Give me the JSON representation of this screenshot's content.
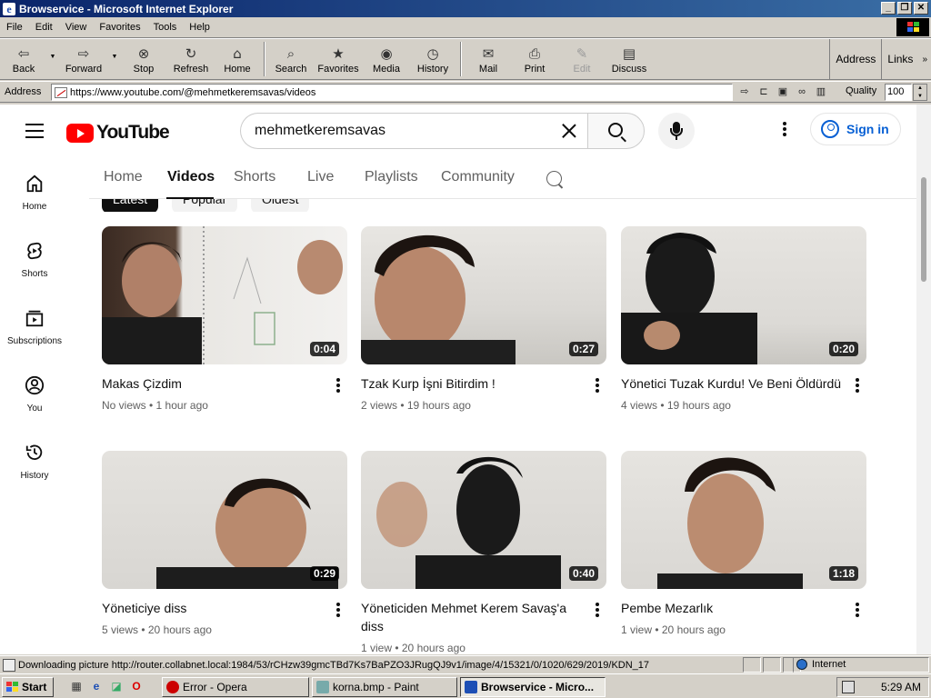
{
  "window": {
    "title": "Browservice - Microsoft Internet Explorer",
    "buttons": [
      "_",
      "❐",
      "✕"
    ]
  },
  "menubar": {
    "items": [
      "File",
      "Edit",
      "View",
      "Favorites",
      "Tools",
      "Help"
    ]
  },
  "toolbar": {
    "back": "Back",
    "forward": "Forward",
    "stop": "Stop",
    "refresh": "Refresh",
    "home": "Home",
    "search": "Search",
    "favorites": "Favorites",
    "media": "Media",
    "history": "History",
    "mail": "Mail",
    "print": "Print",
    "edit": "Edit",
    "discuss": "Discuss",
    "address": "Address",
    "links": "Links"
  },
  "addressbar": {
    "label": "Address",
    "url": "https://www.youtube.com/@mehmetkeremsavas/videos",
    "quality_label": "Quality",
    "quality_value": "100"
  },
  "youtube": {
    "logo_text": "YouTube",
    "search_query": "mehmetkeremsavas",
    "signin": "Sign in",
    "sidebar": [
      {
        "label": "Home",
        "icon": "home-icon"
      },
      {
        "label": "Shorts",
        "icon": "shorts-icon"
      },
      {
        "label": "Subscriptions",
        "icon": "subscriptions-icon"
      },
      {
        "label": "You",
        "icon": "you-icon"
      },
      {
        "label": "History",
        "icon": "history-icon"
      }
    ],
    "tabs": [
      "Home",
      "Videos",
      "Shorts",
      "Live",
      "Playlists",
      "Community"
    ],
    "active_tab": "Videos",
    "chips": [
      "Latest",
      "Popular",
      "Oldest"
    ],
    "videos": [
      {
        "title": "Makas Çizdim",
        "duration": "0:04",
        "meta": "No views • 1 hour ago"
      },
      {
        "title": "Tzak Kurp İşni Bitirdim !",
        "duration": "0:27",
        "meta": "2 views • 19 hours ago"
      },
      {
        "title": "Yönetici Tuzak Kurdu! Ve Beni Öldürdü",
        "duration": "0:20",
        "meta": "4 views • 19 hours ago"
      },
      {
        "title": "Yöneticiye diss",
        "duration": "0:29",
        "meta": "5 views • 20 hours ago"
      },
      {
        "title": "Yöneticiden Mehmet Kerem Savaş'a diss",
        "duration": "0:40",
        "meta": "1 view • 20 hours ago"
      },
      {
        "title": "Pembe Mezarlık",
        "duration": "1:18",
        "meta": "1 view • 20 hours ago"
      }
    ]
  },
  "statusbar": {
    "text": "Downloading picture http://router.collabnet.local:1984/53/rCHzw39gmcTBd7Ks7BaPZO3JRugQJ9v1/image/4/15321/0/1020/629/2019/KDN_17",
    "zone": "Internet"
  },
  "taskbar": {
    "start": "Start",
    "tasks": [
      "Error - Opera",
      "korna.bmp - Paint",
      "Browservice - Micro..."
    ],
    "clock": "5:29 AM"
  },
  "colors": {
    "title_bar": "#0a246a",
    "youtube_red": "#ff0000",
    "link_blue": "#065fd4"
  }
}
